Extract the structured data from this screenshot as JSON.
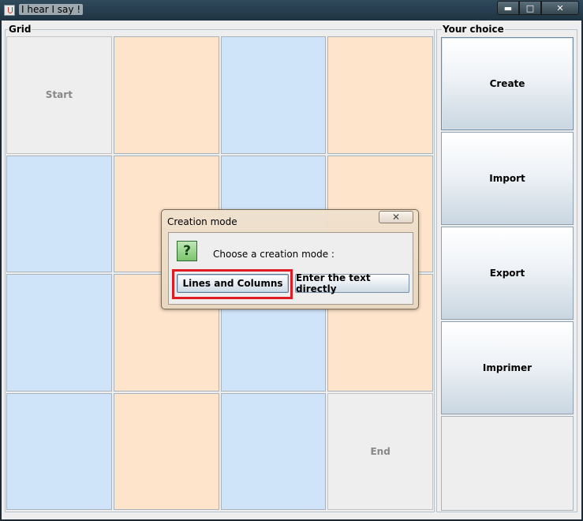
{
  "window": {
    "title": "I hear I say !"
  },
  "caption": {
    "minimize": "▬",
    "maximize": "□",
    "close": "✕"
  },
  "grid_panel": {
    "label": "Grid"
  },
  "choice_panel": {
    "label": "Your choice"
  },
  "grid": {
    "cells": [
      {
        "label": "Start",
        "color": "gray"
      },
      {
        "label": "",
        "color": "peach"
      },
      {
        "label": "",
        "color": "blue"
      },
      {
        "label": "",
        "color": "peach"
      },
      {
        "label": "",
        "color": "blue"
      },
      {
        "label": "",
        "color": "peach"
      },
      {
        "label": "",
        "color": "blue"
      },
      {
        "label": "",
        "color": "peach"
      },
      {
        "label": "",
        "color": "blue"
      },
      {
        "label": "",
        "color": "peach"
      },
      {
        "label": "",
        "color": "blue"
      },
      {
        "label": "",
        "color": "peach"
      },
      {
        "label": "",
        "color": "blue"
      },
      {
        "label": "",
        "color": "peach"
      },
      {
        "label": "",
        "color": "blue"
      },
      {
        "label": "End",
        "color": "gray"
      }
    ]
  },
  "choices": {
    "create": "Create",
    "import": "Import",
    "export": "Export",
    "print": "Imprimer"
  },
  "dialog": {
    "title": "Creation mode",
    "close": "✕",
    "icon": "?",
    "message": "Choose a creation mode :",
    "lines_columns": "Lines and Columns",
    "text_directly": "Enter the text directly"
  },
  "colors": {
    "peach": "#fde4cb",
    "blue": "#cfe3f9",
    "highlight": "#e01b24"
  }
}
